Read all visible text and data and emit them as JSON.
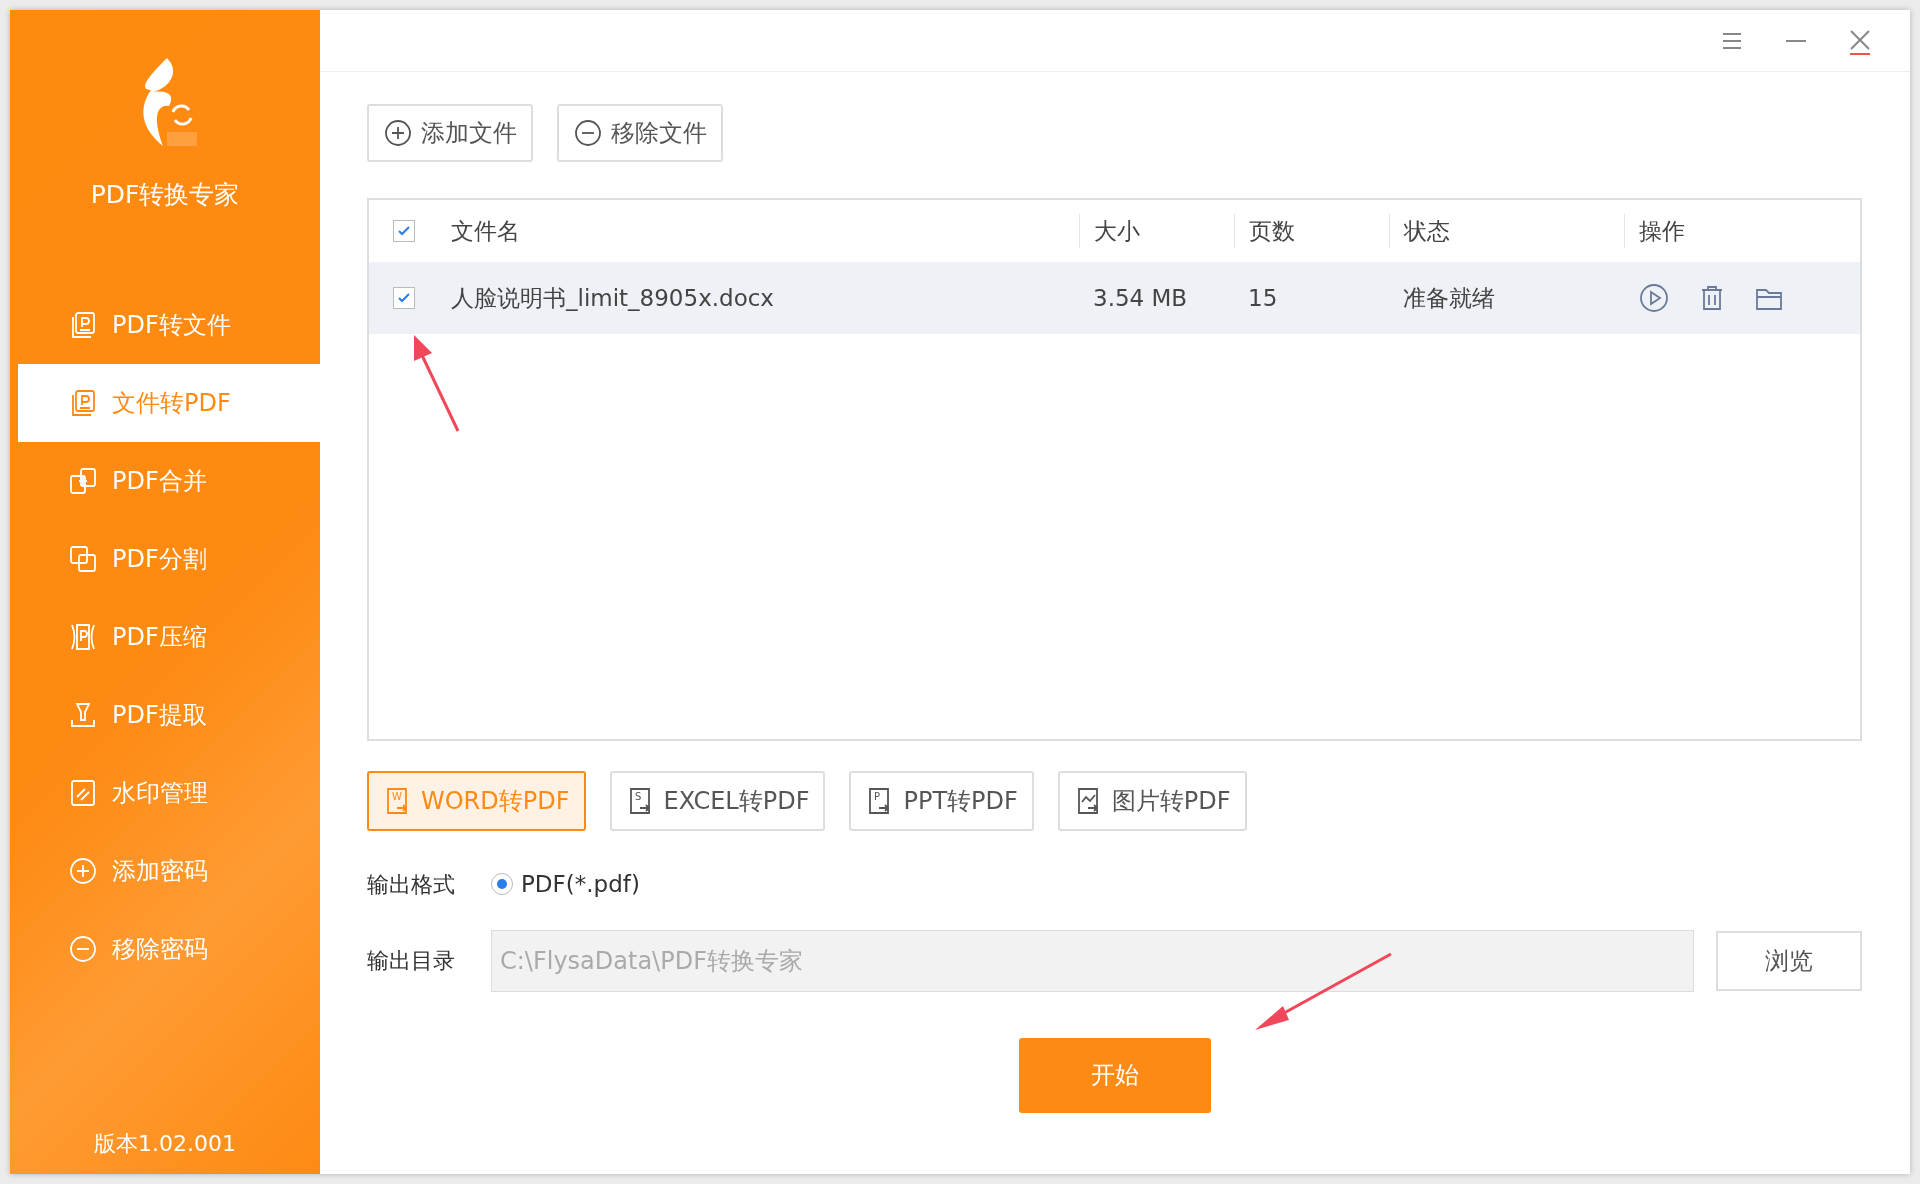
{
  "sidebar": {
    "app_title": "PDF转换专家",
    "items": [
      {
        "label": "PDF转文件",
        "kind": "doc",
        "selected": false
      },
      {
        "label": "文件转PDF",
        "kind": "doc",
        "selected": true
      },
      {
        "label": "PDF合并",
        "kind": "merge",
        "selected": false
      },
      {
        "label": "PDF分割",
        "kind": "split",
        "selected": false
      },
      {
        "label": "PDF压缩",
        "kind": "compress",
        "selected": false
      },
      {
        "label": "PDF提取",
        "kind": "extract",
        "selected": false
      },
      {
        "label": "水印管理",
        "kind": "watermark",
        "selected": false
      },
      {
        "label": "添加密码",
        "kind": "plus",
        "selected": false
      },
      {
        "label": "移除密码",
        "kind": "minus",
        "selected": false
      }
    ],
    "version": "版本1.02.001"
  },
  "toolbar": [
    {
      "label": "添加文件",
      "kind": "plus"
    },
    {
      "label": "移除文件",
      "kind": "minus"
    }
  ],
  "table": {
    "select_all_checked": true,
    "columns": [
      "文件名",
      "大小",
      "页数",
      "状态",
      "操作"
    ],
    "rows": [
      {
        "checked": true,
        "name": "人脸说明书_limit_8905x.docx",
        "size": "3.54 MB",
        "pages": "15",
        "status": "准备就绪"
      }
    ]
  },
  "convert_tabs": [
    {
      "label": "WORD转PDF",
      "letter": "W",
      "selected": true
    },
    {
      "label": "EXCEL转PDF",
      "letter": "S",
      "selected": false
    },
    {
      "label": "PPT转PDF",
      "letter": "P",
      "selected": false
    },
    {
      "label": "图片转PDF",
      "selected": false
    }
  ],
  "output_format": {
    "label": "输出格式",
    "options": [
      {
        "label": "PDF(*.pdf)",
        "selected": true
      }
    ]
  },
  "output_dir": {
    "label": "输出目录",
    "value": "C:\\FlysaData\\PDF转换专家",
    "disabled": true,
    "browse": "浏览"
  },
  "start_button": "开始"
}
